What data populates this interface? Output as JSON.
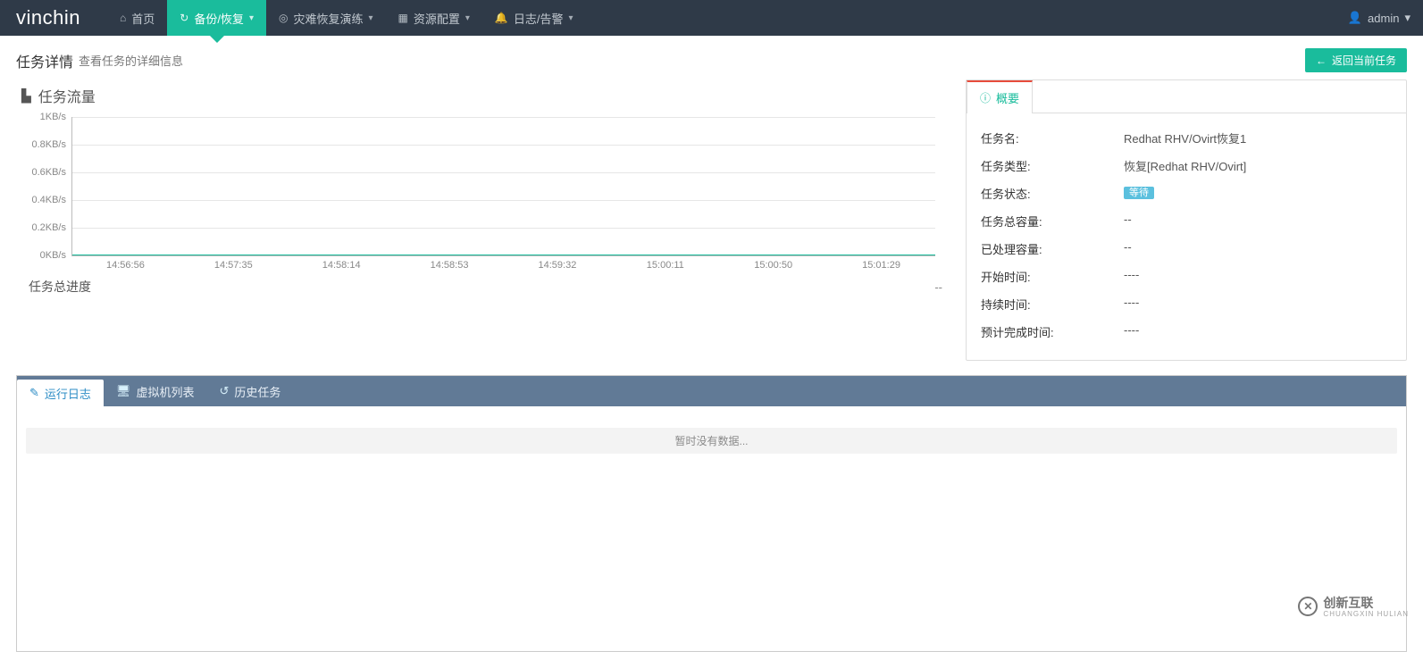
{
  "brand": "vinchin",
  "nav": {
    "items": [
      {
        "icon": "home",
        "label": "首页"
      },
      {
        "icon": "refresh",
        "label": "备份/恢复",
        "active": true
      },
      {
        "icon": "lifebuoy",
        "label": "灾难恢复演练"
      },
      {
        "icon": "resources",
        "label": "资源配置"
      },
      {
        "icon": "bell",
        "label": "日志/告警"
      }
    ],
    "user": {
      "name": "admin"
    }
  },
  "header": {
    "title": "任务详情",
    "subtitle": "查看任务的详细信息",
    "back_label": "返回当前任务"
  },
  "flow": {
    "title": "任务流量"
  },
  "chart_data": {
    "type": "line",
    "title": "任务流量",
    "xlabel": "",
    "ylabel": "KB/s",
    "ylim": [
      0,
      1
    ],
    "y_ticks": [
      "0KB/s",
      "0.2KB/s",
      "0.4KB/s",
      "0.6KB/s",
      "0.8KB/s",
      "1KB/s"
    ],
    "x_categories": [
      "14:56:56",
      "14:57:35",
      "14:58:14",
      "14:58:53",
      "14:59:32",
      "15:00:11",
      "15:00:50",
      "15:01:29"
    ],
    "series": [
      {
        "name": "flow",
        "values": [
          0,
          0,
          0,
          0,
          0,
          0,
          0,
          0
        ]
      }
    ]
  },
  "progress": {
    "label": "任务总进度",
    "value": "--"
  },
  "summary": {
    "tab_label": "概要",
    "rows": {
      "task_name": {
        "k": "任务名:",
        "v": "Redhat RHV/Ovirt恢复1"
      },
      "task_type": {
        "k": "任务类型:",
        "v": "恢复[Redhat RHV/Ovirt]"
      },
      "task_status": {
        "k": "任务状态:",
        "v": "等待",
        "badge": true
      },
      "total_cap": {
        "k": "任务总容量:",
        "v": "--"
      },
      "done_cap": {
        "k": "已处理容量:",
        "v": "--"
      },
      "start_time": {
        "k": "开始时间:",
        "v": "----"
      },
      "duration": {
        "k": "持续时间:",
        "v": "----"
      },
      "eta": {
        "k": "预计完成时间:",
        "v": "----"
      }
    }
  },
  "bottom_tabs": {
    "run_log": "运行日志",
    "vm_list": "虚拟机列表",
    "history": "历史任务",
    "empty": "暂时没有数据..."
  },
  "footer_logo": {
    "text": "创新互联",
    "sub": "CHUANGXIN HULIAN"
  }
}
